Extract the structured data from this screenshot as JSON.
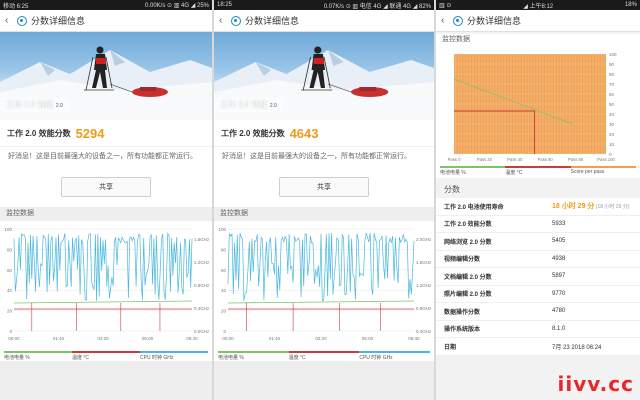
{
  "colors": {
    "accent": "#f09a1a",
    "battery_line": "#7cc36a",
    "temp_line": "#c83c3c",
    "cpu_line": "#49b8e0",
    "orange_fill": "#f0a050"
  },
  "panels": [
    {
      "status": {
        "left": "移动 6:25",
        "mid": "0.00K/s ⊙ ▥ 4G ◢ 25%"
      },
      "title": "分数详细信息",
      "hero_label": "工作 2.0 效能",
      "hero_version": "2.0",
      "score_label": "工作 2.0 效能分数",
      "score_value": "5294",
      "message": "好消息！这是目前最强大的设备之一，所有功能都正常运行。",
      "share": "共享",
      "monitor_title": "监控数据",
      "y_labels": [
        "100",
        "80",
        "60",
        "40",
        "20",
        "0"
      ],
      "y2_labels": [
        "1.6GHz",
        "1.2GHz",
        "0.8GHz",
        "0.4GHz",
        "0.0GHz"
      ],
      "x_labels": [
        "00:00",
        "01:40",
        "03:20",
        "05:00",
        "06:40"
      ],
      "legend": [
        "电池电量 %",
        "温度 °C",
        "CPU 时钟 GHz"
      ]
    },
    {
      "status": {
        "left": "18:25",
        "mid": "0.07K/s ⊙ ▥ 电信 4G ◢ 联通 4G ◢ 82%"
      },
      "title": "分数详细信息",
      "hero_label": "工作 2.0 效能",
      "hero_version": "2.0",
      "score_label": "工作 2.0 效能分数",
      "score_value": "4643",
      "message": "好消息！这是目前最强大的设备之一，所有功能都正常运行。",
      "share": "共享",
      "monitor_title": "监控数据",
      "y_labels": [
        "100",
        "80",
        "60",
        "40",
        "20",
        "0"
      ],
      "y2_labels": [
        "2.0GHz",
        "1.6GHz",
        "1.2GHz",
        "0.8GHz",
        "0.4GHz"
      ],
      "x_labels": [
        "00:00",
        "01:40",
        "03:20",
        "05:00",
        "06:40"
      ],
      "legend": [
        "电池电量 %",
        "温度 °C",
        "CPU 时钟 GHz"
      ]
    }
  ],
  "panel3": {
    "status": {
      "left": "▥ ⊙",
      "mid": "◢ 上午8:12",
      "right": "18%"
    },
    "title": "分数详细信息",
    "monitor_title": "监控数据",
    "y_labels": [
      "100",
      "90",
      "80",
      "70",
      "60",
      "50",
      "40",
      "30",
      "20",
      "10",
      "0"
    ],
    "x_labels": [
      "Pass 0",
      "Pass 20",
      "Pass 40",
      "Pass 60",
      "Pass 80",
      "Pass 100"
    ],
    "legend": [
      "电池电量 %",
      "温度 °C",
      "Score per pass"
    ],
    "scores_title": "分数",
    "rows": [
      {
        "k": "工作 2.0 电池使用寿命",
        "v": "18 小时 29 分",
        "small": "(18 小时 29 分)",
        "highlight": true
      },
      {
        "k": "工作 2.0 效能分数",
        "v": "5933"
      },
      {
        "k": "网络浏览 2.0 分数",
        "v": "5405"
      },
      {
        "k": "视频编辑分数",
        "v": "4938"
      },
      {
        "k": "文档编辑 2.0 分数",
        "v": "5897"
      },
      {
        "k": "照片编辑 2.0 分数",
        "v": "9770"
      },
      {
        "k": "数据操作分数",
        "v": "4780"
      },
      {
        "k": "操作系统版本",
        "v": "8.1.0"
      },
      {
        "k": "日期",
        "v": "7月 23 2018 06:24"
      }
    ]
  },
  "watermark": "iivv.cc"
}
